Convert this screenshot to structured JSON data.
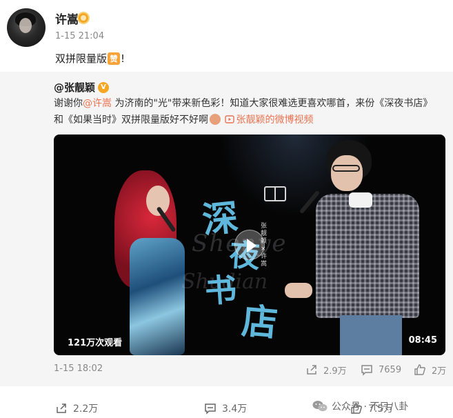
{
  "post": {
    "username": "许嵩",
    "time": "1-15 21:04",
    "text_before": "双拼限量版",
    "emoji": "赞",
    "text_after": "!"
  },
  "repost": {
    "author": "@张靓颖",
    "text_part1": "谢谢你",
    "mention": "@许嵩",
    "text_part2": " 为济南的\"光\"带来新色彩！知道大家很难选更喜欢哪首，来份《深夜书店》和《如果当时》双拼限量版好不好啊",
    "video_link": "张靓颖的微博视频",
    "video": {
      "title_chars": [
        "深",
        "夜",
        "书",
        "店"
      ],
      "script_text": "Shenye",
      "script_text2": "Shudian",
      "credit": "张靓颖×许嵩",
      "view_count": "121万次观看",
      "duration": "08:45"
    },
    "time": "1-15 18:02",
    "reposts": "2.9万",
    "comments": "7659",
    "likes": "2万"
  },
  "footer": {
    "reposts": "2.2万",
    "comments": "3.4万",
    "likes": "7.5万",
    "watermark": "公众号 · 不只八卦"
  }
}
